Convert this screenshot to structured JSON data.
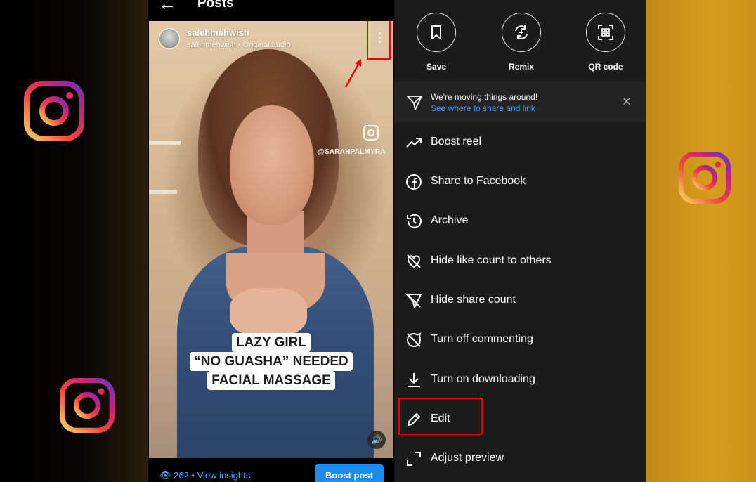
{
  "left_post": {
    "back_label": "←",
    "title": "Posts",
    "username": "salehmehwish",
    "subtitle": "salehmehwish • Original audio",
    "watermark": "@SARAHPALMYRA",
    "caption_lines": [
      "LAZY GIRL",
      "“NO GUASHA” NEEDED",
      "FACIAL MASSAGE"
    ],
    "insights": "👁 262 • View insights",
    "boost_button": "Boost post"
  },
  "share_sheet": {
    "quick_actions": [
      {
        "label": "Save",
        "icon": "bookmark-icon"
      },
      {
        "label": "Remix",
        "icon": "remix-icon"
      },
      {
        "label": "QR code",
        "icon": "qr-code-icon"
      }
    ],
    "notice": {
      "title": "We're moving things around!",
      "link": "See where to share and link",
      "close": "✕"
    },
    "menu": [
      {
        "label": "Boost reel",
        "icon": "trending-up-icon"
      },
      {
        "label": "Share to Facebook",
        "icon": "facebook-icon"
      },
      {
        "label": "Archive",
        "icon": "archive-history-icon"
      },
      {
        "label": "Hide like count to others",
        "icon": "heart-off-icon"
      },
      {
        "label": "Hide share count",
        "icon": "send-off-icon"
      },
      {
        "label": "Turn off commenting",
        "icon": "comment-off-icon"
      },
      {
        "label": "Turn on downloading",
        "icon": "download-icon"
      },
      {
        "label": "Edit",
        "icon": "pencil-icon"
      },
      {
        "label": "Adjust preview",
        "icon": "crop-corners-icon"
      }
    ]
  },
  "colors": {
    "highlight": "#e00000",
    "link": "#3d9bff",
    "boost_button": "#1b8cf0",
    "panel": "#1c1c1c"
  }
}
